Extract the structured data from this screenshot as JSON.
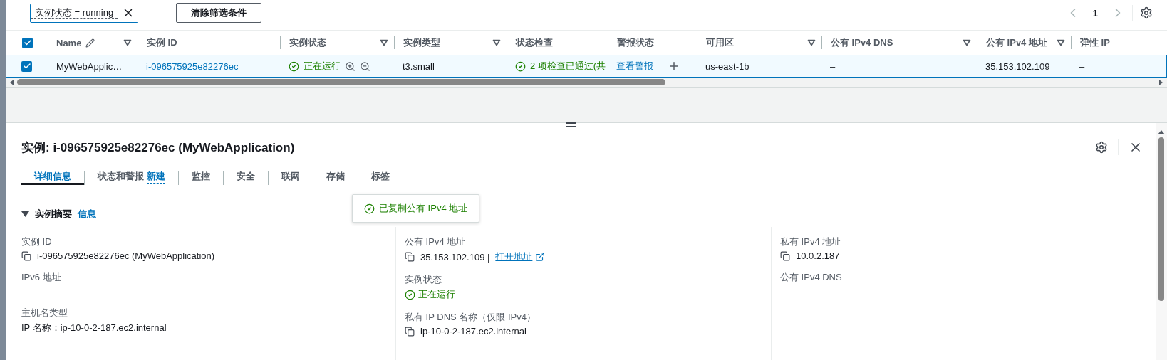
{
  "filter": {
    "token": "实例状态 = running",
    "clear_label": "清除筛选条件"
  },
  "pagination": {
    "page": "1"
  },
  "table": {
    "all_checked": true,
    "columns": [
      {
        "label": "Name",
        "editable": true,
        "filter": true
      },
      {
        "label": "实例 ID",
        "editable": false,
        "filter": false
      },
      {
        "label": "实例状态",
        "editable": false,
        "filter": true
      },
      {
        "label": "实例类型",
        "editable": false,
        "filter": true
      },
      {
        "label": "状态检查",
        "editable": false,
        "filter": false
      },
      {
        "label": "警报状态",
        "editable": false,
        "filter": false
      },
      {
        "label": "可用区",
        "editable": false,
        "filter": true
      },
      {
        "label": "公有 IPv4 DNS",
        "editable": false,
        "filter": true
      },
      {
        "label": "公有 IPv4 地址",
        "editable": false,
        "filter": true
      },
      {
        "label": "弹性 IP",
        "editable": false,
        "filter": false
      }
    ],
    "rows": [
      {
        "selected": true,
        "cells": [
          {
            "kind": "text",
            "text": "MyWebApplic…"
          },
          {
            "kind": "link",
            "text": "i-096575925e82276ec"
          },
          {
            "kind": "status",
            "text": "正在运行"
          },
          {
            "kind": "text",
            "text": "t3.small"
          },
          {
            "kind": "check",
            "text": "2 项检查已通过(共"
          },
          {
            "kind": "alarm",
            "text": "查看警报"
          },
          {
            "kind": "text",
            "text": "us-east-1b"
          },
          {
            "kind": "text",
            "text": "–"
          },
          {
            "kind": "text",
            "text": "35.153.102.109"
          },
          {
            "kind": "text",
            "text": "–"
          }
        ]
      }
    ]
  },
  "detail": {
    "title": "实例: i-096575925e82276ec (MyWebApplication)",
    "tabs": [
      {
        "label": "详细信息",
        "selected": true
      },
      {
        "label": "状态和警报",
        "badge": "新建",
        "selected": false
      },
      {
        "label": "监控",
        "selected": false
      },
      {
        "label": "安全",
        "selected": false
      },
      {
        "label": "联网",
        "selected": false
      },
      {
        "label": "存储",
        "selected": false
      },
      {
        "label": "标签",
        "selected": false
      }
    ],
    "section": {
      "title": "实例摘要",
      "info": "信息",
      "expanded": true
    },
    "toast": {
      "text": "已复制公有 IPv4 地址"
    },
    "columns": [
      [
        {
          "label": "实例 ID",
          "kind": "copy",
          "value": "i-096575925e82276ec (MyWebApplication)"
        },
        {
          "label": "IPv6 地址",
          "kind": "plain",
          "value": "–"
        },
        {
          "label": "主机名类型",
          "kind": "plain",
          "value": "IP 名称：ip-10-0-2-187.ec2.internal"
        }
      ],
      [
        {
          "label": "公有 IPv4 地址",
          "kind": "copy-link",
          "value": "35.153.102.109 |",
          "link": "打开地址"
        },
        {
          "label": "实例状态",
          "kind": "status",
          "value": "正在运行"
        },
        {
          "label": "私有 IP DNS 名称（仅限 IPv4）",
          "kind": "copy",
          "value": "ip-10-0-2-187.ec2.internal"
        }
      ],
      [
        {
          "label": "私有 IPv4 地址",
          "kind": "copy",
          "value": "10.0.2.187"
        },
        {
          "label": "公有 IPv4 DNS",
          "kind": "plain",
          "value": "–"
        }
      ]
    ]
  }
}
